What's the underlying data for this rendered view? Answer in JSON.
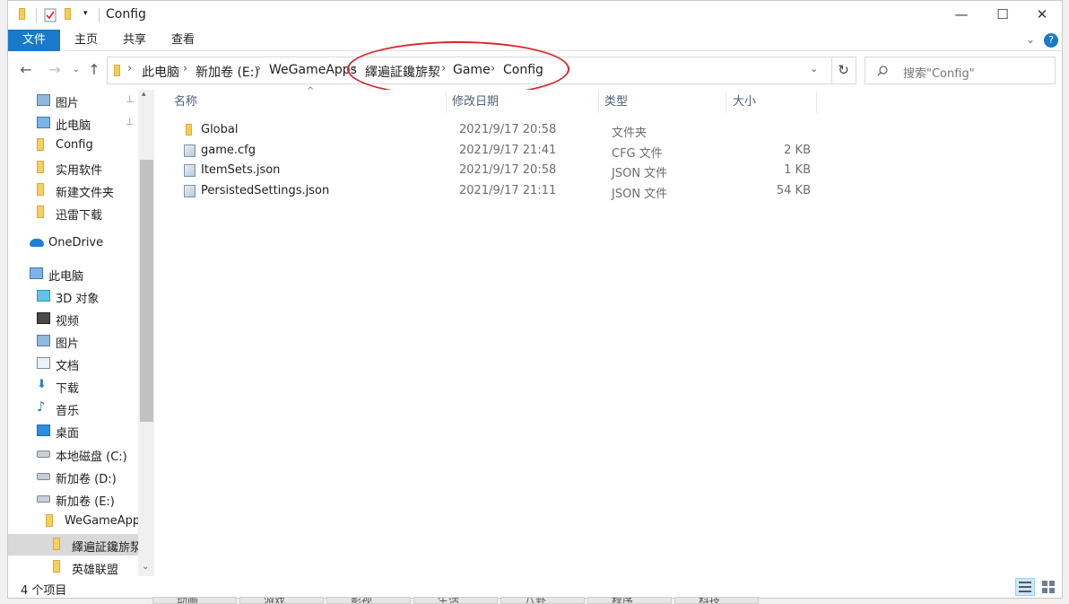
{
  "window": {
    "title": "Config",
    "controls": {
      "minimize": "—",
      "maximize": "☐",
      "close": "✕"
    }
  },
  "ribbon": {
    "tabs": [
      "文件",
      "主页",
      "共享",
      "查看"
    ]
  },
  "address": {
    "segments": [
      "此电脑",
      "新加卷 (E:)",
      "WeGameApps",
      "繹遍証鑱旂洯",
      "Game",
      "Config"
    ],
    "search_placeholder": "搜索\"Config\""
  },
  "nav_pane": {
    "items": [
      {
        "label": "图片",
        "icon": "pictures-icon",
        "pinned": true
      },
      {
        "label": "此电脑",
        "icon": "this-pc-icon",
        "pinned": true
      },
      {
        "label": "Config",
        "icon": "folder-icon"
      },
      {
        "label": "实用软件",
        "icon": "folder-icon"
      },
      {
        "label": "新建文件夹",
        "icon": "folder-icon"
      },
      {
        "label": "迅雷下载",
        "icon": "folder-icon"
      },
      {
        "label": "OneDrive",
        "icon": "onedrive-icon"
      },
      {
        "label": "此电脑",
        "icon": "this-pc-icon"
      },
      {
        "label": "3D 对象",
        "icon": "3d-objects-icon"
      },
      {
        "label": "视频",
        "icon": "videos-icon"
      },
      {
        "label": "图片",
        "icon": "pictures-icon"
      },
      {
        "label": "文档",
        "icon": "documents-icon"
      },
      {
        "label": "下载",
        "icon": "downloads-icon"
      },
      {
        "label": "音乐",
        "icon": "music-icon"
      },
      {
        "label": "桌面",
        "icon": "desktop-icon"
      },
      {
        "label": "本地磁盘 (C:)",
        "icon": "drive-icon"
      },
      {
        "label": "新加卷 (D:)",
        "icon": "drive-icon"
      },
      {
        "label": "新加卷 (E:)",
        "icon": "drive-icon"
      },
      {
        "label": "WeGameApps",
        "icon": "folder-icon"
      },
      {
        "label": "繹遍証鑱旂洯",
        "icon": "folder-icon",
        "selected": true
      },
      {
        "label": "英雄联盟",
        "icon": "folder-icon"
      }
    ]
  },
  "columns": {
    "name": "名称",
    "modified": "修改日期",
    "type": "类型",
    "size": "大小"
  },
  "files": [
    {
      "name": "Global",
      "modified": "2021/9/17 20:58",
      "type": "文件夹",
      "size": "",
      "icon": "folder-icon"
    },
    {
      "name": "game.cfg",
      "modified": "2021/9/17 21:41",
      "type": "CFG 文件",
      "size": "2 KB",
      "icon": "file-icon"
    },
    {
      "name": "ItemSets.json",
      "modified": "2021/9/17 20:58",
      "type": "JSON 文件",
      "size": "1 KB",
      "icon": "file-icon"
    },
    {
      "name": "PersistedSettings.json",
      "modified": "2021/9/17 21:11",
      "type": "JSON 文件",
      "size": "54 KB",
      "icon": "file-icon"
    }
  ],
  "status": {
    "item_count": "4 个项目"
  },
  "bottom_tabs": [
    "动画",
    "游戏",
    "影视",
    "生活",
    "八卦",
    "程序",
    "科技"
  ],
  "colors": {
    "accent": "#1979ca",
    "annotation": "#d8262b",
    "folder": "#f7cf5c"
  }
}
